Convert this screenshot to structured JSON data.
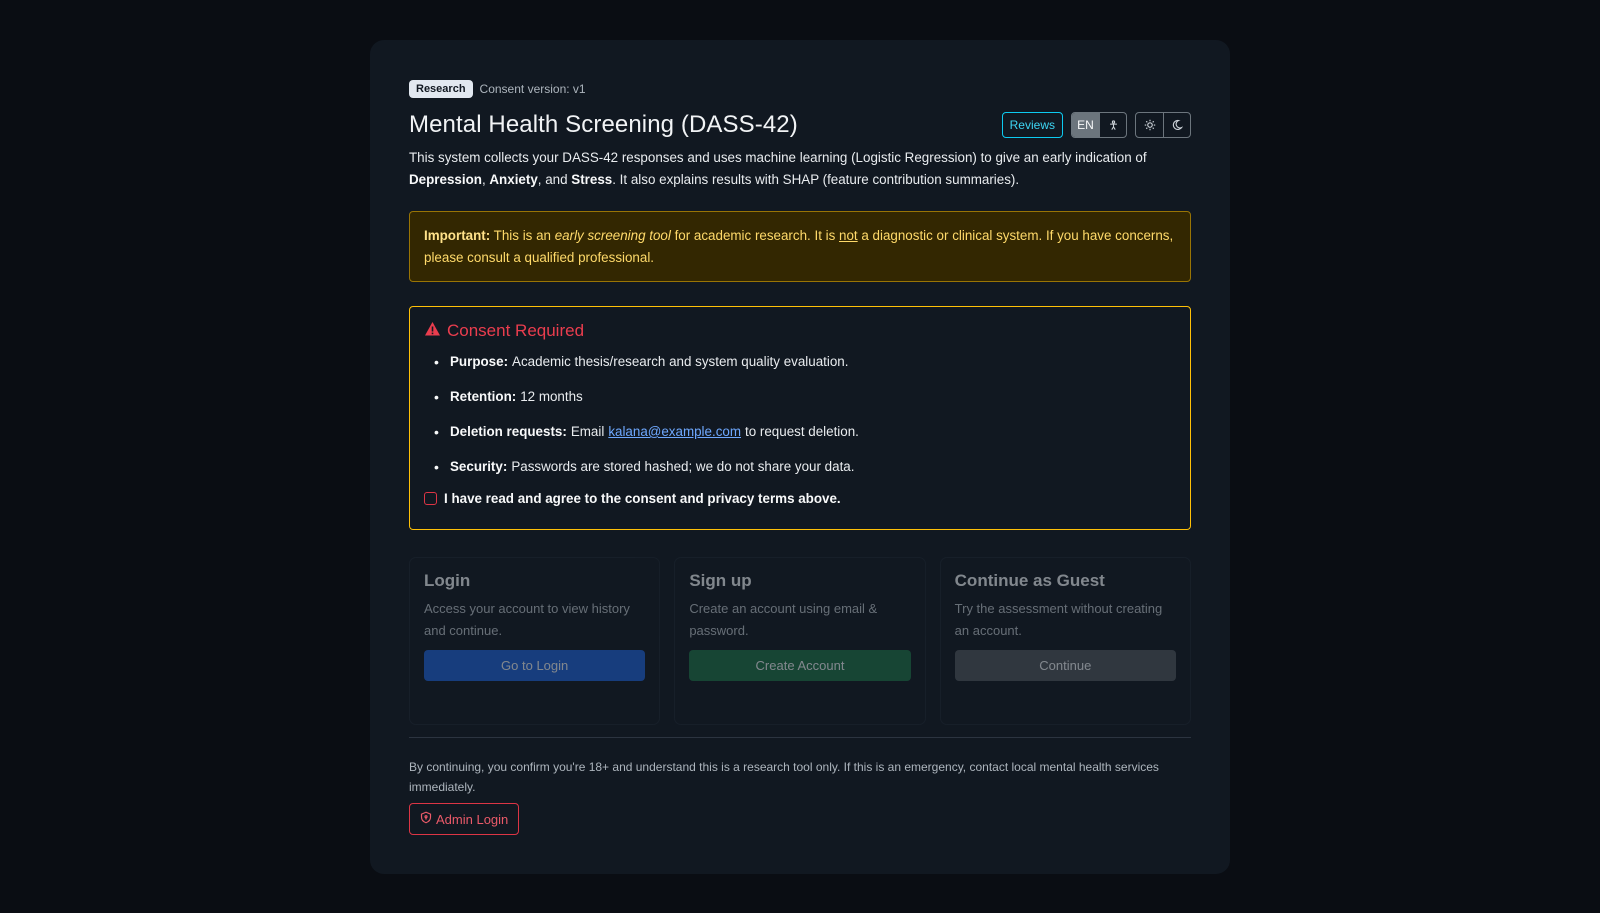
{
  "header": {
    "badge": "Research",
    "consent_version": "Consent version: v1",
    "title": "Mental Health Screening (DASS-42)",
    "reviews_label": "Reviews",
    "lang_label": "EN"
  },
  "intro": {
    "part1": "This system collects your DASS-42 responses and uses machine learning (Logistic Regression) to give an early indication of ",
    "depression": "Depression",
    "sep1": ", ",
    "anxiety": "Anxiety",
    "sep2": ", and ",
    "stress": "Stress",
    "part2": ". It also explains results with SHAP (feature contribution summaries)."
  },
  "warning": {
    "label": "Important:",
    "t1": " This is an ",
    "em": "early screening tool",
    "t2": " for academic research. It is ",
    "not": "not",
    "t3": " a diagnostic or clinical system. If you have concerns, please consult a qualified professional."
  },
  "consent": {
    "title": "Consent Required",
    "purpose_label": "Purpose:",
    "purpose_text": "Academic thesis/research and system quality evaluation.",
    "retention_label": "Retention:",
    "retention_text": "12 months",
    "deletion_label": "Deletion requests:",
    "deletion_pre": "Email",
    "deletion_email": "kalana@example.com",
    "deletion_post": "to request deletion.",
    "security_label": "Security:",
    "security_text": "Passwords are stored hashed; we do not share your data.",
    "agree_label": "I have read and agree to the consent and privacy terms above."
  },
  "options": [
    {
      "title": "Login",
      "desc": "Access your account to view history and continue.",
      "button": "Go to Login"
    },
    {
      "title": "Sign up",
      "desc": "Create an account using email & password.",
      "button": "Create Account"
    },
    {
      "title": "Continue as Guest",
      "desc": "Try the assessment without creating an account.",
      "button": "Continue"
    }
  ],
  "footer": {
    "note": "By continuing, you confirm you're 18+ and understand this is a research tool only. If this is an emergency, contact local mental health services immediately.",
    "admin_label": "Admin Login"
  },
  "icons": [
    "warning-triangle-icon",
    "accessibility-icon",
    "sun-icon",
    "moon-icon",
    "shield-icon"
  ],
  "colors": {
    "accent_warning": "#ffc107",
    "danger": "#dc3545",
    "info": "#0dcaf0"
  }
}
